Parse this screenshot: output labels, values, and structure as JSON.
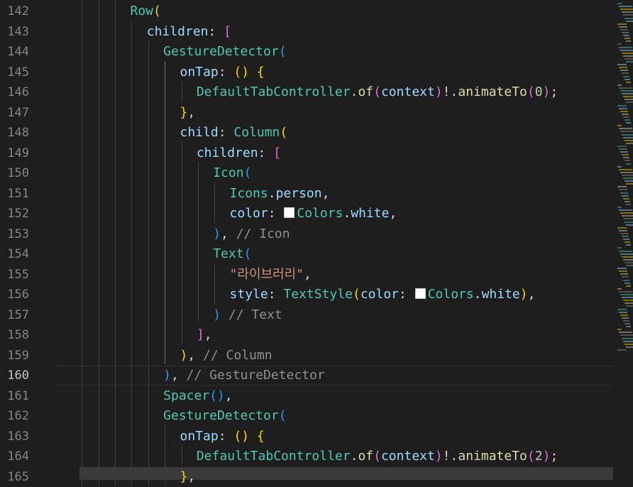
{
  "editor": {
    "active_line": 160,
    "lines": [
      {
        "n": "142",
        "indent": 7,
        "tokens": [
          [
            "cls",
            "Row"
          ],
          [
            "b1",
            "("
          ]
        ]
      },
      {
        "n": "143",
        "indent": 8,
        "tokens": [
          [
            "prop",
            "children"
          ],
          [
            "punc",
            ": "
          ],
          [
            "b2",
            "["
          ]
        ]
      },
      {
        "n": "144",
        "indent": 9,
        "tokens": [
          [
            "cls",
            "GestureDetector"
          ],
          [
            "b3",
            "("
          ]
        ]
      },
      {
        "n": "145",
        "indent": 10,
        "tokens": [
          [
            "prop",
            "onTap"
          ],
          [
            "punc",
            ": "
          ],
          [
            "b1",
            "() {"
          ]
        ]
      },
      {
        "n": "146",
        "indent": 11,
        "tokens": [
          [
            "cls",
            "DefaultTabController"
          ],
          [
            "punc",
            "."
          ],
          [
            "fn",
            "of"
          ],
          [
            "b2",
            "("
          ],
          [
            "prop",
            "context"
          ],
          [
            "b2",
            ")"
          ],
          [
            "punc",
            "!."
          ],
          [
            "fn",
            "animateTo"
          ],
          [
            "b2",
            "("
          ],
          [
            "num",
            "0"
          ],
          [
            "b2",
            ")"
          ],
          [
            "punc",
            ";"
          ]
        ]
      },
      {
        "n": "147",
        "indent": 10,
        "tokens": [
          [
            "b1",
            "}"
          ],
          [
            "punc",
            ","
          ]
        ]
      },
      {
        "n": "148",
        "indent": 10,
        "tokens": [
          [
            "prop",
            "child"
          ],
          [
            "punc",
            ": "
          ],
          [
            "cls",
            "Column"
          ],
          [
            "b1",
            "("
          ]
        ]
      },
      {
        "n": "149",
        "indent": 11,
        "tokens": [
          [
            "prop",
            "children"
          ],
          [
            "punc",
            ": "
          ],
          [
            "b2",
            "["
          ]
        ]
      },
      {
        "n": "150",
        "indent": 12,
        "tokens": [
          [
            "cls",
            "Icon"
          ],
          [
            "b3",
            "("
          ]
        ]
      },
      {
        "n": "151",
        "indent": 13,
        "tokens": [
          [
            "cls",
            "Icons"
          ],
          [
            "punc",
            "."
          ],
          [
            "prop",
            "person"
          ],
          [
            "punc",
            ","
          ]
        ]
      },
      {
        "n": "152",
        "indent": 13,
        "tokens": [
          [
            "prop",
            "color"
          ],
          [
            "punc",
            ": "
          ],
          [
            "swatch",
            ""
          ],
          [
            "cls",
            "Colors"
          ],
          [
            "punc",
            "."
          ],
          [
            "prop",
            "white"
          ],
          [
            "punc",
            ","
          ]
        ]
      },
      {
        "n": "153",
        "indent": 12,
        "tokens": [
          [
            "b3",
            ")"
          ],
          [
            "punc",
            ", "
          ],
          [
            "cmt",
            "// Icon"
          ]
        ]
      },
      {
        "n": "154",
        "indent": 12,
        "tokens": [
          [
            "cls",
            "Text"
          ],
          [
            "b3",
            "("
          ]
        ]
      },
      {
        "n": "155",
        "indent": 13,
        "tokens": [
          [
            "str",
            "\"라이브러리\""
          ],
          [
            "punc",
            ","
          ]
        ]
      },
      {
        "n": "156",
        "indent": 13,
        "tokens": [
          [
            "prop",
            "style"
          ],
          [
            "punc",
            ": "
          ],
          [
            "cls",
            "TextStyle"
          ],
          [
            "b1",
            "("
          ],
          [
            "prop",
            "color"
          ],
          [
            "punc",
            ": "
          ],
          [
            "swatch",
            ""
          ],
          [
            "cls",
            "Colors"
          ],
          [
            "punc",
            "."
          ],
          [
            "prop",
            "white"
          ],
          [
            "b1",
            ")"
          ],
          [
            "punc",
            ","
          ]
        ]
      },
      {
        "n": "157",
        "indent": 12,
        "tokens": [
          [
            "b3",
            ")"
          ],
          [
            "punc",
            " "
          ],
          [
            "cmt",
            "// Text"
          ]
        ]
      },
      {
        "n": "158",
        "indent": 11,
        "tokens": [
          [
            "b2",
            "]"
          ],
          [
            "punc",
            ","
          ]
        ]
      },
      {
        "n": "159",
        "indent": 10,
        "tokens": [
          [
            "b1",
            ")"
          ],
          [
            "punc",
            ", "
          ],
          [
            "cmt",
            "// Column"
          ]
        ]
      },
      {
        "n": "160",
        "indent": 9,
        "tokens": [
          [
            "b3",
            ")"
          ],
          [
            "punc",
            ", "
          ],
          [
            "cmt",
            "// GestureDetector"
          ]
        ]
      },
      {
        "n": "161",
        "indent": 9,
        "tokens": [
          [
            "cls",
            "Spacer"
          ],
          [
            "b3",
            "()"
          ],
          [
            "punc",
            ","
          ]
        ]
      },
      {
        "n": "162",
        "indent": 9,
        "tokens": [
          [
            "cls",
            "GestureDetector"
          ],
          [
            "b3",
            "("
          ]
        ]
      },
      {
        "n": "163",
        "indent": 10,
        "tokens": [
          [
            "prop",
            "onTap"
          ],
          [
            "punc",
            ": "
          ],
          [
            "b1",
            "() {"
          ]
        ]
      },
      {
        "n": "164",
        "indent": 11,
        "tokens": [
          [
            "cls",
            "DefaultTabController"
          ],
          [
            "punc",
            "."
          ],
          [
            "fn",
            "of"
          ],
          [
            "b2",
            "("
          ],
          [
            "prop",
            "context"
          ],
          [
            "b2",
            ")"
          ],
          [
            "punc",
            "!."
          ],
          [
            "fn",
            "animateTo"
          ],
          [
            "b2",
            "("
          ],
          [
            "num",
            "2"
          ],
          [
            "b2",
            ")"
          ],
          [
            "punc",
            ";"
          ]
        ]
      },
      {
        "n": "165",
        "indent": 10,
        "tokens": [
          [
            "b1",
            "}"
          ],
          [
            "punc",
            ","
          ]
        ]
      }
    ]
  },
  "colors": {
    "background": "#1e1e1e",
    "class": "#4ec9b0",
    "function": "#dcdcaa",
    "property": "#9cdcfe",
    "string": "#ce9178",
    "comment": "#8f8f8f",
    "bracket_1": "#ffd700",
    "bracket_2": "#da70d6",
    "bracket_3": "#179fff"
  }
}
